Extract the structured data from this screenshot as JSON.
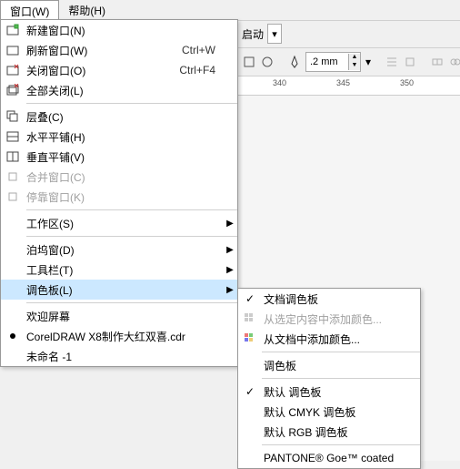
{
  "menubar": {
    "window": "窗口(W)",
    "help": "帮助(H)"
  },
  "menu": {
    "new_window": "新建窗口(N)",
    "refresh_window": "刷新窗口(W)",
    "refresh_window_shortcut": "Ctrl+W",
    "close_window": "关闭窗口(O)",
    "close_window_shortcut": "Ctrl+F4",
    "close_all": "全部关闭(L)",
    "cascade": "层叠(C)",
    "tile_h": "水平平铺(H)",
    "tile_v": "垂直平铺(V)",
    "merge": "合并窗口(C)",
    "stop": "停靠窗口(K)",
    "workspace": "工作区(S)",
    "dockers": "泊坞窗(D)",
    "toolbars": "工具栏(T)",
    "palettes": "调色板(L)",
    "welcome": "欢迎屏幕",
    "doc1": "CorelDRAW X8制作大红双喜.cdr",
    "doc2": "未命名 -1"
  },
  "submenu": {
    "doc_palette": "文档调色板",
    "add_from_sel": "从选定内容中添加颜色...",
    "add_from_doc": "从文档中添加颜色...",
    "palette": "调色板",
    "default_palette": "默认 调色板",
    "default_cmyk": "默认 CMYK 调色板",
    "default_rgb": "默认 RGB 调色板",
    "pantone": "PANTONE® Goe™ coated"
  },
  "toolbar": {
    "launch": "启动",
    "stroke_width": ".2 mm"
  },
  "ruler": {
    "m340": "340",
    "m345": "345",
    "m350": "350"
  },
  "icons": {
    "new_win": "new-window-icon",
    "refresh": "refresh-icon",
    "close": "close-icon",
    "close_all": "close-all-icon",
    "cascade": "cascade-icon",
    "tile_h": "tile-horizontal-icon",
    "tile_v": "tile-vertical-icon",
    "merge": "merge-icon",
    "stop": "stop-icon",
    "palette_grid": "palette-grid-icon",
    "palette_add": "palette-add-icon",
    "check": "checkmark-icon"
  }
}
